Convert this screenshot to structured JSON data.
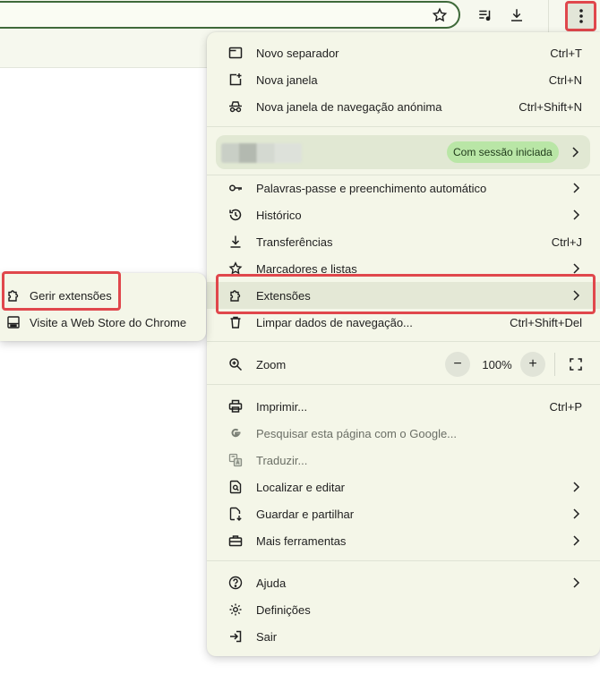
{
  "menu": {
    "items_top": [
      {
        "icon": "new-tab-icon",
        "label": "Novo separador",
        "shortcut": "Ctrl+T"
      },
      {
        "icon": "new-window-icon",
        "label": "Nova janela",
        "shortcut": "Ctrl+N"
      },
      {
        "icon": "incognito-icon",
        "label": "Nova janela de navegação anónima",
        "shortcut": "Ctrl+Shift+N"
      }
    ],
    "profile": {
      "status_badge": "Com sessão iniciada"
    },
    "items_mid": [
      {
        "icon": "key-icon",
        "label": "Palavras-passe e preenchimento automático",
        "shortcut": ""
      },
      {
        "icon": "history-icon",
        "label": "Histórico",
        "shortcut": ""
      },
      {
        "icon": "download-icon",
        "label": "Transferências",
        "shortcut": "Ctrl+J"
      },
      {
        "icon": "star-icon",
        "label": "Marcadores e listas",
        "shortcut": ""
      },
      {
        "icon": "extension-icon",
        "label": "Extensões",
        "shortcut": ""
      },
      {
        "icon": "trash-icon",
        "label": "Limpar dados de navegação...",
        "shortcut": "Ctrl+Shift+Del"
      }
    ],
    "zoom": {
      "label": "Zoom",
      "value": "100%",
      "minus": "−",
      "plus": "+"
    },
    "items_tools": [
      {
        "icon": "print-icon",
        "label": "Imprimir...",
        "shortcut": "Ctrl+P"
      },
      {
        "icon": "google-icon",
        "label": "Pesquisar esta página com o Google..."
      },
      {
        "icon": "translate-icon",
        "label": "Traduzir..."
      },
      {
        "icon": "find-icon",
        "label": "Localizar e editar"
      },
      {
        "icon": "save-share-icon",
        "label": "Guardar e partilhar"
      },
      {
        "icon": "toolbox-icon",
        "label": "Mais ferramentas"
      }
    ],
    "items_bottom": [
      {
        "icon": "help-icon",
        "label": "Ajuda"
      },
      {
        "icon": "settings-icon",
        "label": "Definições"
      },
      {
        "icon": "exit-icon",
        "label": "Sair"
      }
    ]
  },
  "submenu": {
    "items": [
      {
        "icon": "extension-icon",
        "label": "Gerir extensões"
      },
      {
        "icon": "web-store-icon",
        "label": "Visite a Web Store do Chrome"
      }
    ]
  },
  "colors": {
    "accent": "#3f6a3a",
    "highlight": "#e0474c",
    "menu_bg": "#f4f6e8",
    "badge": "#b9e6a6"
  }
}
